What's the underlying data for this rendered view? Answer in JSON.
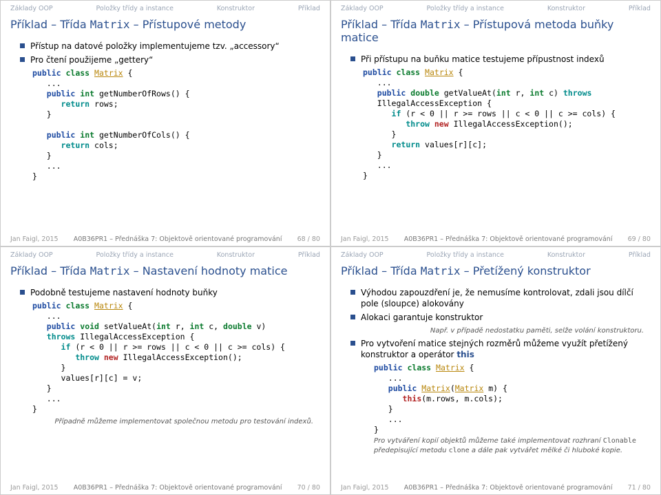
{
  "nav": {
    "a": "Základy OOP",
    "b": "Položky třídy a instance",
    "c": "Konstruktor",
    "d": "Příklad"
  },
  "footer": {
    "author": "Jan Faigl, 2015",
    "course": "A0B36PR1 – Přednáška 7: Objektově orientované programování"
  },
  "s68": {
    "title_pre": "Příklad – Třída ",
    "title_tt": "Matrix",
    "title_post": " – Přístupové metody",
    "b1": "Přístup na datové položky implementujeme tzv. „accessory“",
    "b2": "Pro čtení použijeme „gettery“",
    "page": "68 / 80"
  },
  "s69": {
    "title_pre": "Příklad – Třída ",
    "title_tt": "Matrix",
    "title_post": " – Přístupová metoda buňky matice",
    "b1": "Při přístupu na buňku matice testujeme přípustnost indexů",
    "page": "69 / 80"
  },
  "s70": {
    "title_pre": "Příklad – Třída ",
    "title_tt": "Matrix",
    "title_post": " – Nastavení hodnoty matice",
    "b1": "Podobně testujeme nastavení hodnoty buňky",
    "note": "Případně můžeme implementovat společnou metodu pro testování indexů.",
    "page": "70 / 80"
  },
  "s71": {
    "title_pre": "Příklad – Třída ",
    "title_tt": "Matrix",
    "title_post": " – Přetížený konstruktor",
    "b1": "Výhodou zapouzdření je, že nemusíme kontrolovat, zdali jsou dílčí pole (sloupce) alokovány",
    "b2": "Alokaci garantuje konstruktor",
    "note1": "Např. v případě nedostatku paměti, selže volání konstruktoru.",
    "b3_pre": "Pro vytvoření matice stejných rozměrů můžeme využít přetížený konstruktor a operátor ",
    "b3_th": "this",
    "note2a": "Pro vytváření kopií objektů můžeme také implementovat rozhraní ",
    "note2b": "Clonable",
    "note2c": " předepisující metodu ",
    "note2d": "clone",
    "note2e": " a dále pak vytvářet mělké či hluboké kopie.",
    "page": "71 / 80"
  }
}
